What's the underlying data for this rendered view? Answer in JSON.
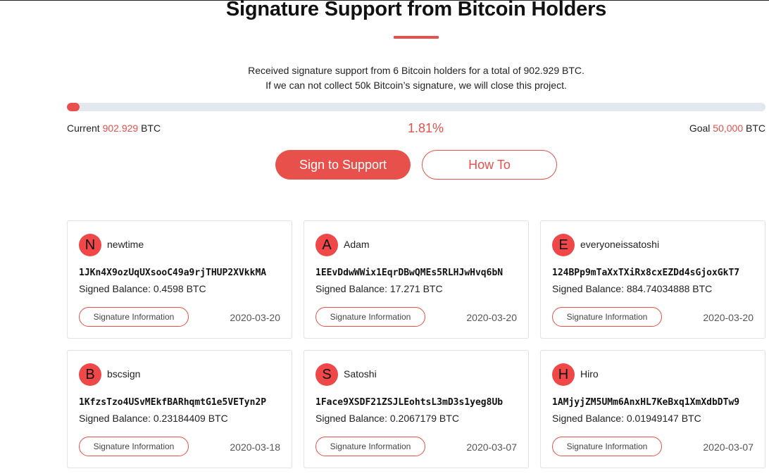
{
  "header": {
    "title": "Signature Support from Bitcoin Holders",
    "accent_color": "#e8504b",
    "desc_line1": "Received signature support from 6 Bitcoin holders for a total of 902.929 BTC.",
    "desc_line2": "If we can not collect 50k Bitcoin’s signature, we will close this project."
  },
  "progress": {
    "fraction": 0.0181,
    "current_label": "Current",
    "current_value": "902.929",
    "current_unit": "BTC",
    "percent": "1.81%",
    "goal_label": "Goal",
    "goal_value": "50,000",
    "goal_unit": "BTC"
  },
  "actions": {
    "sign_label": "Sign to Support",
    "howto_label": "How To"
  },
  "cards": [
    {
      "initial": "N",
      "name": "newtime",
      "address": "1JKn4X9ozUqUXsooC49a9rjTHUP2XVkkMA",
      "balance": "Signed Balance: 0.4598 BTC",
      "button": "Signature Information",
      "date": "2020-03-20"
    },
    {
      "initial": "A",
      "name": "Adam",
      "address": "1EEvDdwWWix1EqrDBwQMEs5RLHJwHvq6bN",
      "balance": "Signed Balance: 17.271 BTC",
      "button": "Signature Information",
      "date": "2020-03-20"
    },
    {
      "initial": "E",
      "name": "everyoneissatoshi",
      "address": "124BPp9mTaXxTXiRx8cxEZDd4sGjoxGkT7",
      "balance": "Signed Balance: 884.74034888 BTC",
      "button": "Signature Information",
      "date": "2020-03-20"
    },
    {
      "initial": "B",
      "name": "bscsign",
      "address": "1KfzsTzo4USvMEkfBARhqmtG1e5VETyn2P",
      "balance": "Signed Balance: 0.23184409 BTC",
      "button": "Signature Information",
      "date": "2020-03-18"
    },
    {
      "initial": "S",
      "name": "Satoshi",
      "address": "1Face9XSDF21ZSJLEohtsL3mD3s1yeg8Ub",
      "balance": "Signed Balance: 0.2067179 BTC",
      "button": "Signature Information",
      "date": "2020-03-07"
    },
    {
      "initial": "H",
      "name": "Hiro",
      "address": "1AMjyjZM5UMm6AnxHL7KeBxq1XmXdbDTw9",
      "balance": "Signed Balance: 0.01949147 BTC",
      "button": "Signature Information",
      "date": "2020-03-07"
    }
  ]
}
